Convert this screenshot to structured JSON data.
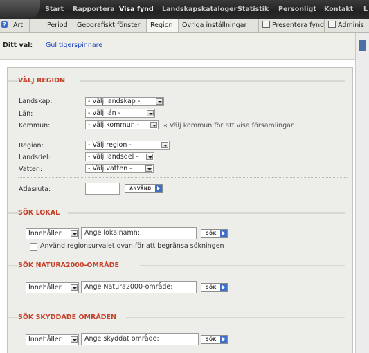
{
  "topnav": {
    "items": [
      {
        "label": "Start",
        "active": false
      },
      {
        "label": "Rapportera",
        "active": false
      },
      {
        "label": "Visa fynd",
        "active": true
      },
      {
        "label": "Landskapskataloger",
        "active": false
      },
      {
        "label": "Statistik",
        "active": false
      },
      {
        "label": "Personligt",
        "active": false
      },
      {
        "label": "Kontakt",
        "active": false
      },
      {
        "label": "L",
        "active": false
      }
    ]
  },
  "subnav": {
    "help_icon": "question-icon",
    "tabs": [
      {
        "label": "Art"
      },
      {
        "label": "Period"
      },
      {
        "label": "Geografiskt fönster"
      },
      {
        "label": "Region",
        "active": true
      },
      {
        "label": "Övriga inställningar"
      },
      {
        "label": "Presentera fynd",
        "icon": "monitor-icon"
      },
      {
        "label": "Adminis",
        "icon": "edit-icon"
      }
    ]
  },
  "choice": {
    "label": "Ditt val:",
    "value": "Gul tigerspinnare"
  },
  "region_section": {
    "title": "VÄLJ REGION",
    "fields": [
      {
        "label": "Landskap:",
        "value": "- välj landskap -"
      },
      {
        "label": "Län:",
        "value": "- välj län -"
      },
      {
        "label": "Kommun:",
        "value": "- välj kommun -"
      },
      {
        "label": "Region:",
        "value": "- Välj region -"
      },
      {
        "label": "Landsdel:",
        "value": "- Välj landsdel -"
      },
      {
        "label": "Vatten:",
        "value": "- Välj vatten -"
      }
    ],
    "kommun_hint": "« Välj kommun för att visa församlingar",
    "atlas_label": "Atlasruta:",
    "atlas_value": "",
    "use_button": "ANVÄND"
  },
  "lokal_section": {
    "title": "SÖK LOKAL",
    "mode": "Innehåller",
    "placeholder": "Ange lokalnamn:",
    "search_button": "SÖK",
    "checkbox_label": "Använd regionsurvalet ovan för att begränsa sökningen",
    "checkbox_checked": false
  },
  "natura_section": {
    "title": "SÖK NATURA2000-OMRÅDE",
    "mode": "Innehåller",
    "placeholder": "Ange Natura2000-område:",
    "search_button": "SÖK"
  },
  "skyddade_section": {
    "title": "SÖK SKYDDADE OMRÅDEN",
    "mode": "Innehåller",
    "placeholder": "Ange skyddat område:",
    "search_button": "SÖK"
  },
  "colors": {
    "section_title": "#c5422b",
    "accent_blue": "#3f6fc9",
    "link": "#1a3fbf",
    "nav_bg": "#222222",
    "panel_bg": "#ededea"
  }
}
